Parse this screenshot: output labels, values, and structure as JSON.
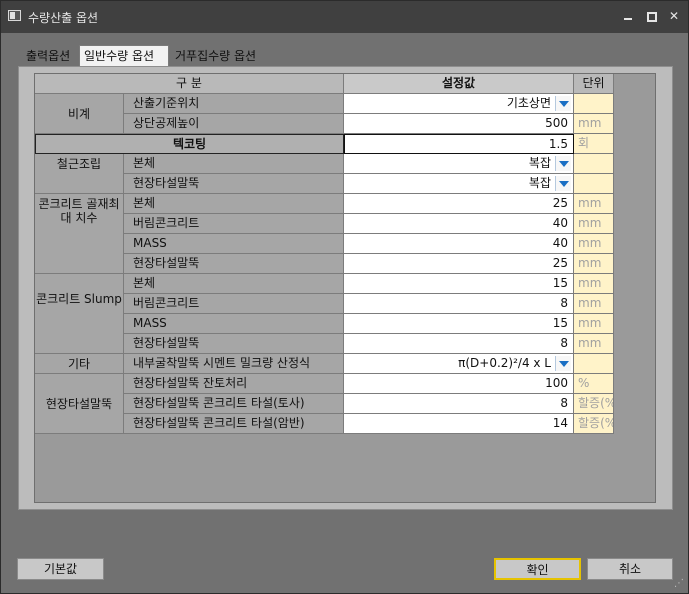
{
  "window": {
    "title": "수량산출 옵션"
  },
  "tabs": [
    {
      "label": "출력옵션"
    },
    {
      "label": "일반수량 옵션"
    },
    {
      "label": "거푸집수량 옵션"
    }
  ],
  "grid": {
    "headers": {
      "category": "구 분",
      "value": "설정값",
      "unit": "단위"
    },
    "categories": {
      "bigye": "비계",
      "rebar": "철근조립",
      "aggregate": "콘크리트 골재최대 치수",
      "slump": "콘크리트 Slump",
      "etc": "기타",
      "pile": "현장타설말뚝"
    },
    "rows": [
      {
        "item": "산출기준위치",
        "value": "기초상면",
        "unit": ""
      },
      {
        "item": "상단공제높이",
        "value": "500",
        "unit": "mm"
      },
      {
        "item": "텍코팅",
        "value": "1.5",
        "unit": "회"
      },
      {
        "item": "본체",
        "value": "복잡",
        "unit": ""
      },
      {
        "item": "현장타설말뚝",
        "value": "복잡",
        "unit": ""
      },
      {
        "item": "본체",
        "value": "25",
        "unit": "mm"
      },
      {
        "item": "버림콘크리트",
        "value": "40",
        "unit": "mm"
      },
      {
        "item": "MASS",
        "value": "40",
        "unit": "mm"
      },
      {
        "item": "현장타설말뚝",
        "value": "25",
        "unit": "mm"
      },
      {
        "item": "본체",
        "value": "15",
        "unit": "mm"
      },
      {
        "item": "버림콘크리트",
        "value": "8",
        "unit": "mm"
      },
      {
        "item": "MASS",
        "value": "15",
        "unit": "mm"
      },
      {
        "item": "현장타설말뚝",
        "value": "8",
        "unit": "mm"
      },
      {
        "item": "내부굴착말뚝 시멘트 밀크량 산정식",
        "value": "π(D+0.2)²/4 x L",
        "unit": ""
      },
      {
        "item": "현장타설말뚝 잔토처리",
        "value": "100",
        "unit": "%"
      },
      {
        "item": "현장타설말뚝 콘크리트 타설(토사)",
        "value": "8",
        "unit": "할증(%"
      },
      {
        "item": "현장타설말뚝 콘크리트 타설(암반)",
        "value": "14",
        "unit": "할증(%"
      }
    ]
  },
  "buttons": {
    "default": "기본값",
    "ok": "확인",
    "cancel": "취소"
  }
}
